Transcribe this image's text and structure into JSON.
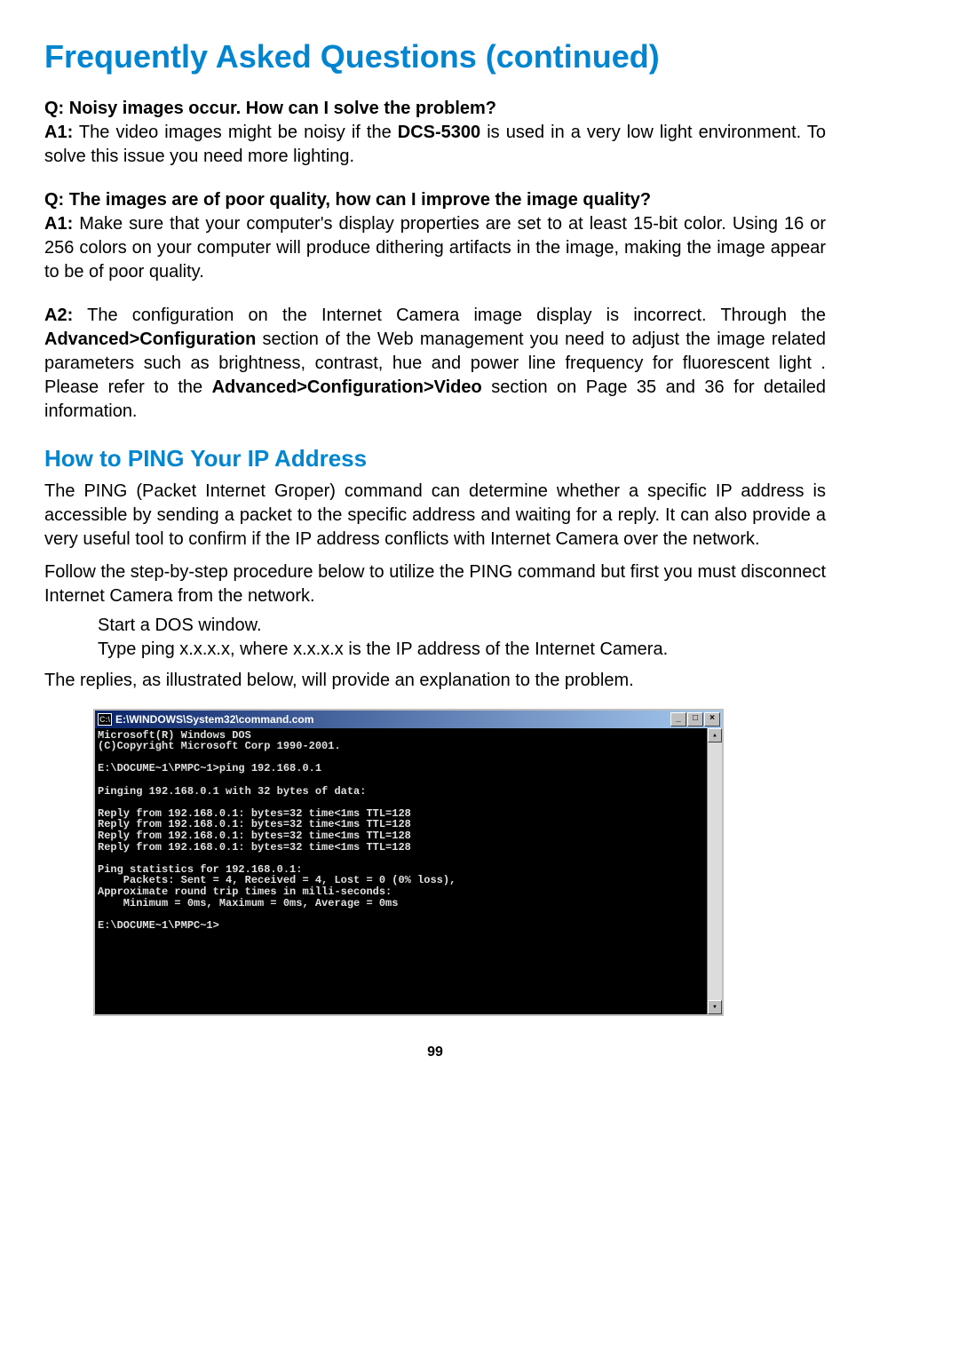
{
  "heading": "Frequently Asked Questions (continued)",
  "faq1": {
    "q": "Q: Noisy images occur. How can I solve the problem?",
    "a1_label": "A1:",
    "a1_text_1": " The video images might be noisy if the ",
    "a1_bold": "DCS-5300",
    "a1_text_2": " is used in a very low light environment. To solve this issue you need more lighting."
  },
  "faq2": {
    "q": "Q: The images are of poor quality, how can I improve the image quality?",
    "a1_label": "A1:",
    "a1_text": " Make sure that your computer's display properties are set to at least 15-bit color. Using 16 or 256 colors on your computer will produce dithering artifacts in the image, making the image appear to be of poor quality.",
    "a2_label": "A2:",
    "a2_text_1": " The configuration on the Internet Camera image display is incorrect. Through the ",
    "a2_bold_1": "Advanced>Configuration",
    "a2_text_2": " section of the Web management you need to adjust the image related parameters such as brightness, contrast, hue and power line frequency for fluorescent light . Please refer to the ",
    "a2_bold_2": "Advanced>Configuration>Video",
    "a2_text_3": " section on Page 35 and 36 for detailed information."
  },
  "ping": {
    "heading": "How to PING Your IP Address",
    "p1": "The PING (Packet Internet Groper) command can determine whether a specific IP address is accessible by sending a packet to the specific address and waiting for a reply. It can also provide a very useful tool to confirm if the IP address conflicts with Internet Camera over the network.",
    "p2": "Follow the step-by-step procedure below to utilize the PING command but first you must disconnect Internet Camera from the network.",
    "step1": "Start a DOS window.",
    "step2": "Type ping x.x.x.x, where x.x.x.x is the IP address of the Internet Camera.",
    "p3": "The replies, as illustrated below, will provide an explanation to the  problem."
  },
  "dos": {
    "title": "E:\\WINDOWS\\System32\\command.com",
    "icon_text": "C:\\",
    "min": "_",
    "max": "□",
    "close": "×",
    "up": "▴",
    "down": "▾",
    "content": "Microsoft(R) Windows DOS\n(C)Copyright Microsoft Corp 1990-2001.\n\nE:\\DOCUME~1\\PMPC~1>ping 192.168.0.1\n\nPinging 192.168.0.1 with 32 bytes of data:\n\nReply from 192.168.0.1: bytes=32 time<1ms TTL=128\nReply from 192.168.0.1: bytes=32 time<1ms TTL=128\nReply from 192.168.0.1: bytes=32 time<1ms TTL=128\nReply from 192.168.0.1: bytes=32 time<1ms TTL=128\n\nPing statistics for 192.168.0.1:\n    Packets: Sent = 4, Received = 4, Lost = 0 (0% loss),\nApproximate round trip times in milli-seconds:\n    Minimum = 0ms, Maximum = 0ms, Average = 0ms\n\nE:\\DOCUME~1\\PMPC~1>"
  },
  "page_number": "99"
}
